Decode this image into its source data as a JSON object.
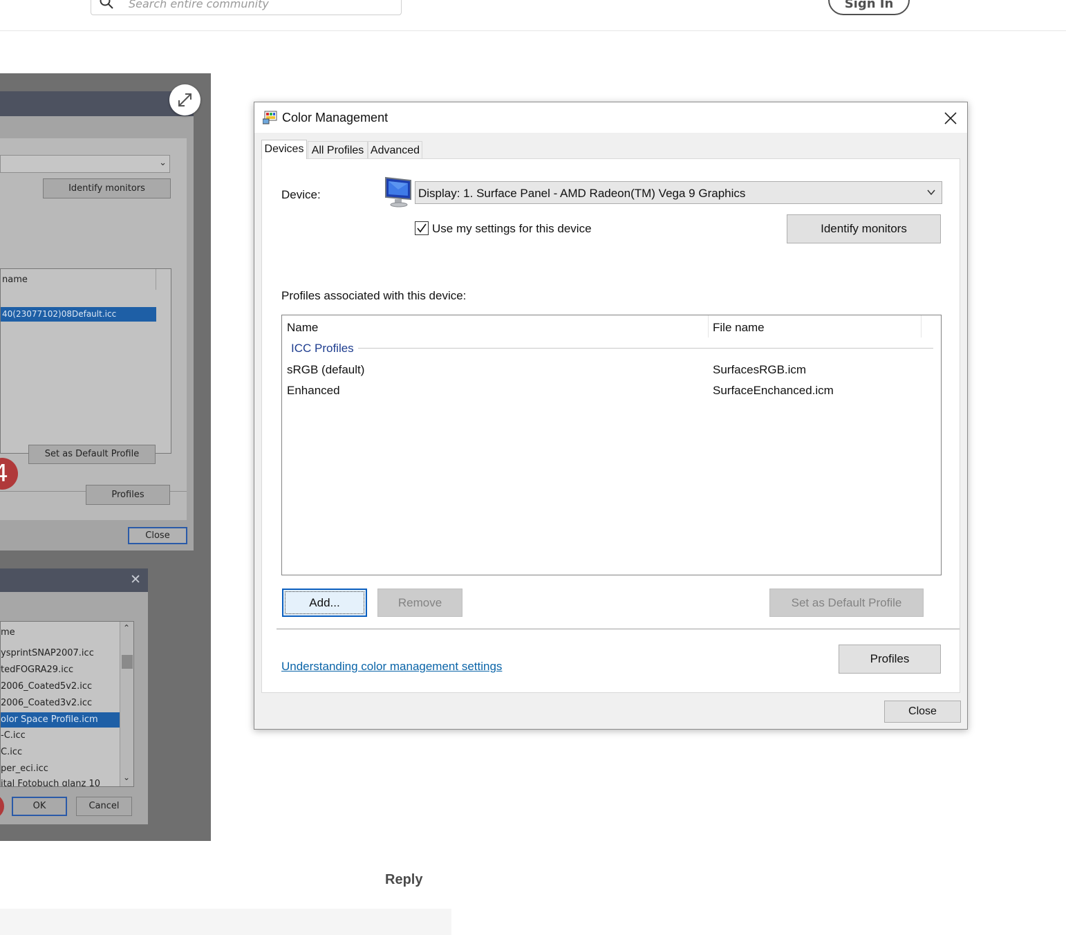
{
  "header": {
    "search_placeholder": "Search entire community",
    "signin_label": "Sign In"
  },
  "left_screenshot": {
    "expand_icon": "expand-arrows-icon",
    "window1": {
      "identify_label": "Identify monitors",
      "list_header": "name",
      "selected_file": "40(23077102)08Default.icc",
      "badge_number": "4",
      "set_default_label": "Set as Default Profile",
      "profiles_label": "Profiles",
      "close_label": "Close"
    },
    "window2": {
      "list_header": "me",
      "items": [
        "ysprintSNAP2007.icc",
        "tedFOGRA29.icc",
        "2006_Coated5v2.icc",
        "2006_Coated3v2.icc",
        "olor Space Profile.icm",
        "-C.icc",
        "C.icc",
        "per_eci.icc",
        "ital Fotobuch glanz 10"
      ],
      "selected_index": 4,
      "ok_label": "OK",
      "cancel_label": "Cancel"
    }
  },
  "dialog": {
    "title": "Color Management",
    "title_icon": "color-management-icon",
    "tabs": [
      {
        "label": "Devices",
        "active": true
      },
      {
        "label": "All Profiles",
        "active": false
      },
      {
        "label": "Advanced",
        "active": false
      }
    ],
    "device_label": "Device:",
    "device_value": "Display: 1. Surface Panel - AMD Radeon(TM) Vega 9 Graphics",
    "use_settings_label": "Use my settings for this device",
    "use_settings_checked": true,
    "identify_monitors_label": "Identify monitors",
    "profiles_assoc_label": "Profiles associated with this device:",
    "columns": [
      "Name",
      "File name"
    ],
    "group_label": "ICC Profiles",
    "profiles": [
      {
        "name": "sRGB (default)",
        "file": "SurfacesRGB.icm"
      },
      {
        "name": "Enhanced",
        "file": "SurfaceEnchanced.icm"
      }
    ],
    "add_label": "Add...",
    "remove_label": "Remove",
    "set_default_label": "Set as Default Profile",
    "link_label": "Understanding color management settings",
    "profiles_button_label": "Profiles",
    "close_label": "Close"
  },
  "reply_label": "Reply"
}
